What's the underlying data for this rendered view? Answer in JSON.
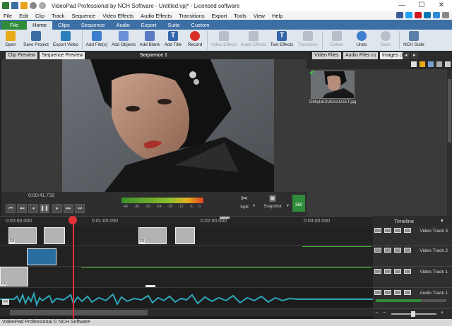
{
  "window": {
    "title": "VideoPad Professional by NCH Software - Untitled.vpj* - Licensed software",
    "minimize": "—",
    "maximize": "☐",
    "close": "✕"
  },
  "menu": [
    "File",
    "Edit",
    "Clip",
    "Track",
    "Sequence",
    "Video Effects",
    "Audio Effects",
    "Transitions",
    "Export",
    "Tools",
    "View",
    "Help"
  ],
  "ribbon_tabs": [
    "File",
    "Home",
    "Clips",
    "Sequence",
    "Audio",
    "Export",
    "Suite",
    "Custom"
  ],
  "toolbar": {
    "open": "Open",
    "save_project": "Save Project",
    "export_video": "Export Video",
    "add_files": "Add File(s)",
    "add_objects": "Add Objects",
    "add_blank": "Add Blank",
    "add_title": "Add Title",
    "record": "Record",
    "video_effects": "Video Effects",
    "audio_effects": "Audio Effects",
    "text_effects": "Text Effects",
    "transition": "Transition",
    "delete": "Delete",
    "undo": "Undo",
    "redo": "Redo",
    "nch_suite": "NCH Suite"
  },
  "preview_tabs": {
    "clip_preview": "Clip Preview",
    "sequence_preview": "Sequence Preview",
    "sequence_title": "Sequence 1"
  },
  "bin_tabs": {
    "video_files": "Video Files",
    "audio_files": "Audio Files",
    "audio_count": "(0)",
    "images": "Images",
    "images_count": "(1)"
  },
  "bin_item": {
    "filename": "DMq16CIUEAAO2ET.jpg"
  },
  "player": {
    "timecode": "0:00:41.732",
    "meter_ticks": [
      "-42",
      "-36",
      "-30",
      "-24",
      "-18",
      "-12",
      "-6",
      "0"
    ],
    "split": "Split",
    "snapshot": "Snapshot",
    "three_sixty": "360"
  },
  "ruler": {
    "marks": [
      "0:00:00.000",
      "0:01:00.000",
      "0:02:00.000",
      "0:03:00.000"
    ]
  },
  "timeline_header": "Timeline",
  "tracks": [
    {
      "name": "Video Track 3"
    },
    {
      "name": "Video Track 2"
    },
    {
      "name": "Video Track 1"
    },
    {
      "name": "Audio Track 1"
    }
  ],
  "status": "VideoPad Professional © NCH Software",
  "colors": {
    "ribbon_blue": "#3d6fa5",
    "file_green": "#2f8c3a",
    "playhead": "#e0303a",
    "waveform": "#2ea6b8"
  }
}
